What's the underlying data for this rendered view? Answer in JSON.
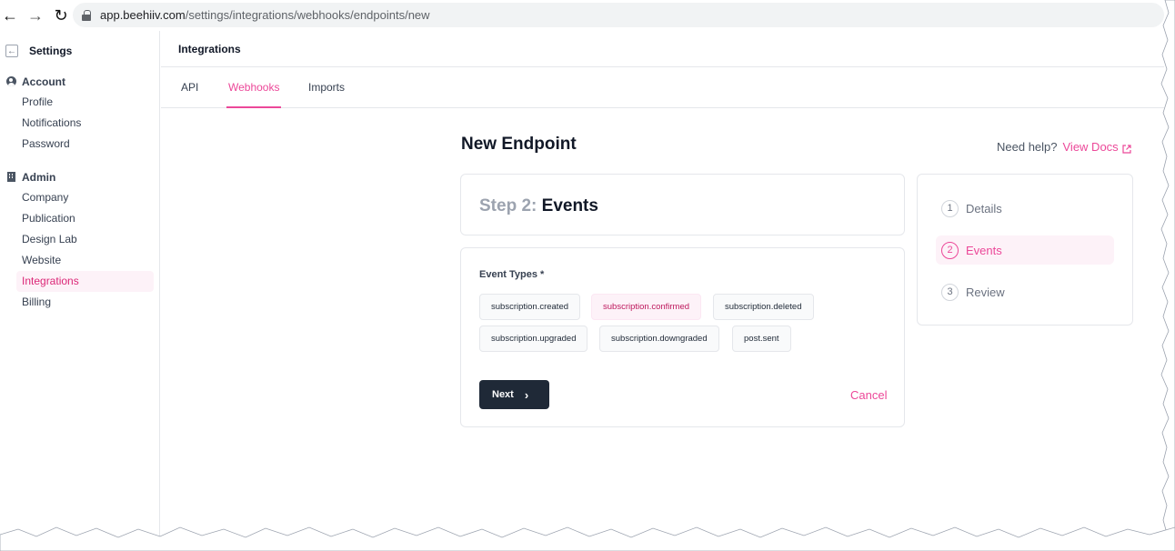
{
  "browser": {
    "url_domain": "app.beehiiv.com",
    "url_path": "/settings/integrations/webhooks/endpoints/new"
  },
  "sidebar": {
    "title": "Settings",
    "groups": [
      {
        "label": "Account",
        "icon": "user-circle-icon",
        "items": [
          {
            "label": "Profile"
          },
          {
            "label": "Notifications"
          },
          {
            "label": "Password"
          }
        ]
      },
      {
        "label": "Admin",
        "icon": "building-icon",
        "items": [
          {
            "label": "Company"
          },
          {
            "label": "Publication"
          },
          {
            "label": "Design Lab"
          },
          {
            "label": "Website"
          },
          {
            "label": "Integrations",
            "active": true
          },
          {
            "label": "Billing"
          }
        ]
      }
    ]
  },
  "header": {
    "title": "Integrations"
  },
  "tabs": [
    {
      "label": "API"
    },
    {
      "label": "Webhooks",
      "active": true
    },
    {
      "label": "Imports"
    }
  ],
  "page": {
    "title": "New Endpoint",
    "help_text": "Need help?",
    "help_link": "View Docs"
  },
  "step": {
    "number_label": "Step 2:",
    "name": "Events"
  },
  "events": {
    "label": "Event Types *",
    "chips": [
      {
        "label": "subscription.created",
        "selected": false
      },
      {
        "label": "subscription.confirmed",
        "selected": true
      },
      {
        "label": "subscription.deleted",
        "selected": false
      },
      {
        "label": "subscription.upgraded",
        "selected": false
      },
      {
        "label": "subscription.downgraded",
        "selected": false
      },
      {
        "label": "post.sent",
        "selected": false
      }
    ],
    "next_label": "Next",
    "cancel_label": "Cancel"
  },
  "progress": [
    {
      "num": "1",
      "label": "Details"
    },
    {
      "num": "2",
      "label": "Events",
      "active": true
    },
    {
      "num": "3",
      "label": "Review"
    }
  ],
  "colors": {
    "accent": "#ec4899",
    "dark_button": "#1f2937"
  }
}
